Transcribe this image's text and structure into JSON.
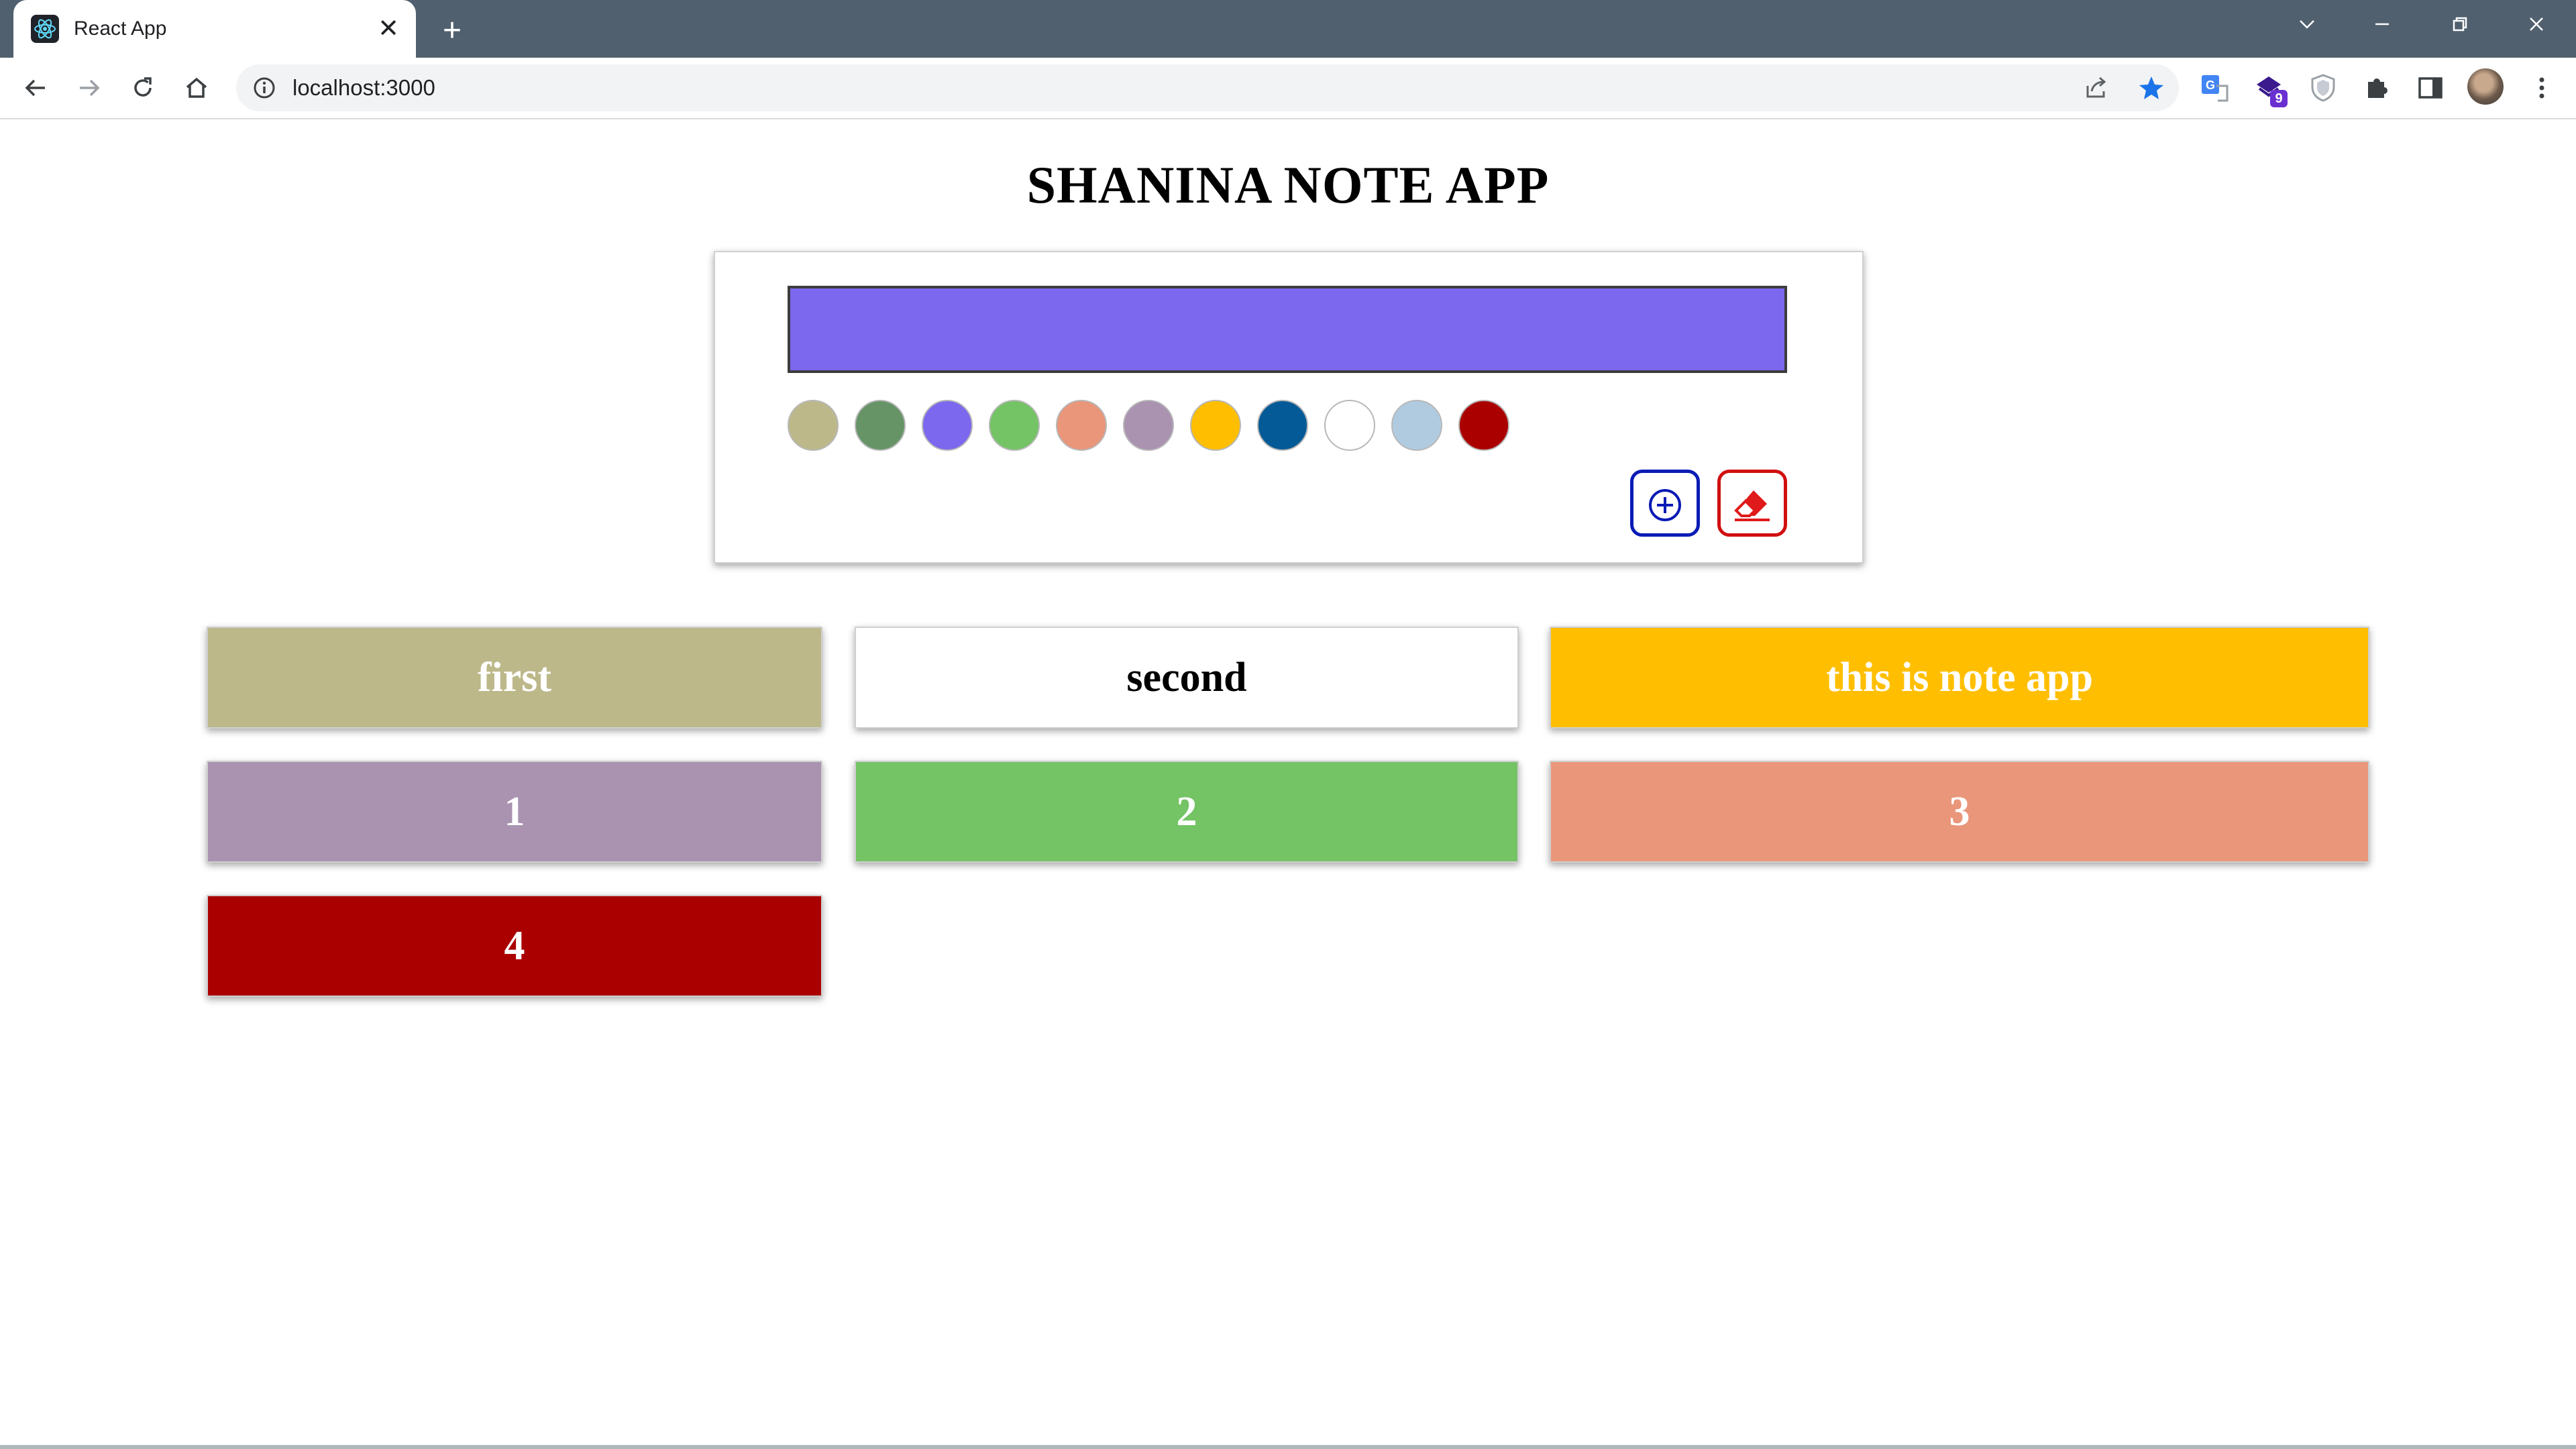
{
  "browser": {
    "tab_title": "React App",
    "tab_close": "✕",
    "new_tab": "+",
    "url": "localhost:3000",
    "extension_badge": "9"
  },
  "app": {
    "title": "SHANINA NOTE APP",
    "input_value": "",
    "selected_color": "#7b68ee",
    "palette": [
      "#bdb88a",
      "#669467",
      "#7b68ee",
      "#74c365",
      "#e9967a",
      "#aa92b1",
      "#ffbf00",
      "#035a96",
      "#ffffff",
      "#b0cbe0",
      "#aa0000"
    ],
    "notes": [
      {
        "text": "first",
        "color": "#bdb88a"
      },
      {
        "text": "second",
        "color": "#ffffff"
      },
      {
        "text": "this is note app",
        "color": "#ffbf00"
      },
      {
        "text": "1",
        "color": "#aa92b1"
      },
      {
        "text": "2",
        "color": "#74c365"
      },
      {
        "text": "3",
        "color": "#e9967a"
      },
      {
        "text": "4",
        "color": "#aa0000"
      }
    ]
  }
}
